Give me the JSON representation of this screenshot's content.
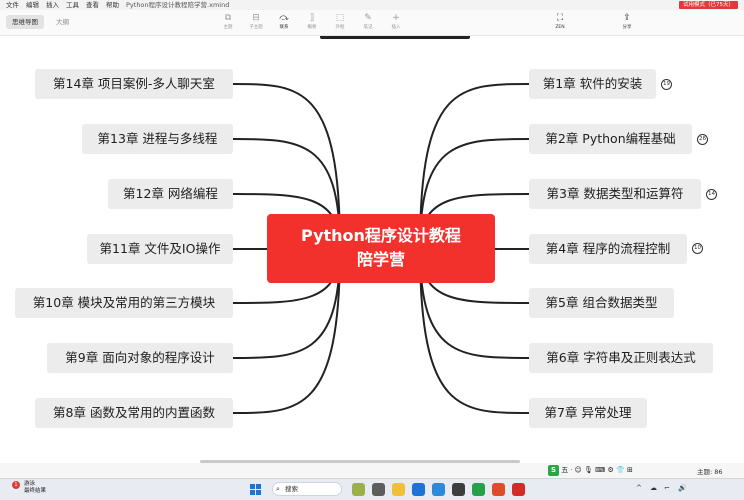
{
  "menubar": {
    "items": [
      "文件",
      "编辑",
      "插入",
      "工具",
      "查看",
      "帮助"
    ],
    "title": "Python程序设计教程陪学营.xmind",
    "trial_badge": "试用模式（已75天）"
  },
  "toolbar": {
    "tabs": [
      "思维导图",
      "大纲"
    ],
    "tools": [
      {
        "label": "主题",
        "icon": "⧉"
      },
      {
        "label": "子主题",
        "icon": "⊟"
      },
      {
        "label": "联系",
        "icon": "⤼"
      },
      {
        "label": "概要",
        "icon": "⟧"
      },
      {
        "label": "外框",
        "icon": "⬚"
      },
      {
        "label": "笔记",
        "icon": "✎"
      },
      {
        "label": "插入",
        "icon": "+"
      }
    ],
    "zen_label": "ZEN",
    "zen_icon": "⛶",
    "share_label": "分享",
    "share_icon": "⇪"
  },
  "mindmap": {
    "center_line1": "Python程序设计教程",
    "center_line2": "陪学营",
    "left": [
      "第14章 项目案例-多人聊天室",
      "第13章 进程与多线程",
      "第12章 网络编程",
      "第11章 文件及IO操作",
      "第10章 模块及常用的第三方模块",
      "第9章 面向对象的程序设计",
      "第8章 函数及常用的内置函数"
    ],
    "right": [
      "第1章 软件的安装",
      "第2章 Python编程基础",
      "第3章 数据类型和运算符",
      "第4章 程序的流程控制",
      "第5章 组合数据类型",
      "第6章 字符串及正则表达式",
      "第7章 异常处理"
    ],
    "badges": [
      "19",
      "26",
      "14",
      "10"
    ]
  },
  "statusbar": {
    "ime": [
      "五",
      "ᐧ",
      "☺",
      "🎙",
      "⌨",
      "⚙",
      "👕",
      "⊞"
    ],
    "ime_logo": "S",
    "topic_count": "主题: 86"
  },
  "taskbar": {
    "weather_line1": "游泳",
    "weather_line2": "最终结果",
    "weather_badge": "1",
    "search_placeholder": "搜索",
    "search_icon": "⌕",
    "apps": [
      "#9bb04a",
      "#5d5d5d",
      "#f2c037",
      "#1e73d6",
      "#2d8ad9",
      "#3d3d3d",
      "#27a04a",
      "#e04b2b",
      "#d42a2a"
    ],
    "tray": [
      "^",
      "☁",
      "⌐",
      "🔊"
    ]
  },
  "colors": {
    "center": "#f2312d",
    "node_bg": "#ececec",
    "branch": "#222222"
  }
}
